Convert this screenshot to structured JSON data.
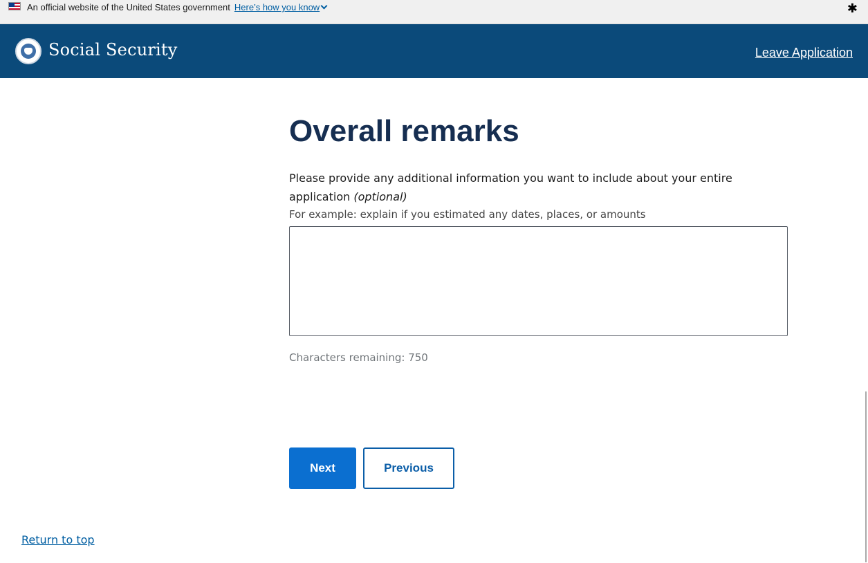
{
  "gov_banner": {
    "text": "An official website of the United States government",
    "link": "Here’s how you know"
  },
  "header": {
    "site_title": "Social Security",
    "leave_link": "Leave Application"
  },
  "main": {
    "title": "Overall remarks",
    "prompt": "Please provide any additional information you want to include about your entire application",
    "prompt_optional": "(optional)",
    "hint": "For example: explain if you estimated any dates, places, or amounts",
    "remarks_value": "",
    "characters_remaining": "Characters remaining: 750"
  },
  "buttons": {
    "next": "Next",
    "previous": "Previous"
  },
  "footer": {
    "return_to_top": "Return to top"
  },
  "colors": {
    "header_bg": "#0b4a7a",
    "title": "#162e51",
    "primary_button": "#0b6fd0",
    "link": "#005ea2"
  },
  "icons": [
    "us-flag-icon",
    "chevron-down-icon",
    "gear-icon",
    "ssa-seal-logo"
  ]
}
